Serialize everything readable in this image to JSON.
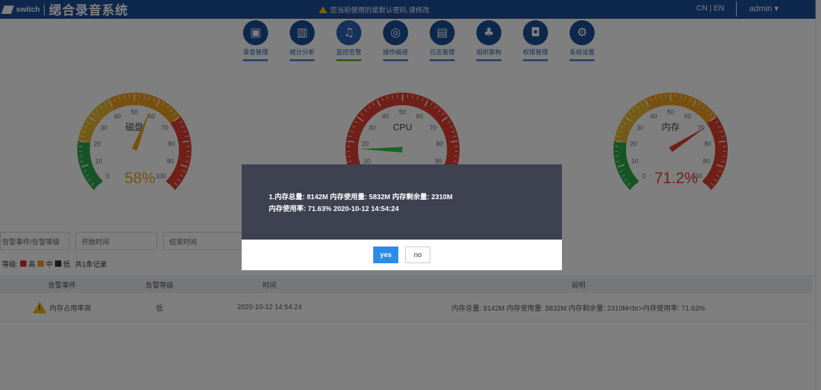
{
  "header": {
    "logo_text": "switch",
    "system_name": "缌合录音系统",
    "warning_text": "您当前使用的是默认密码,请修改",
    "language": "CN | EN",
    "user": "admin ▾"
  },
  "nav": {
    "items": [
      {
        "label": "录音管理",
        "icon": "▣"
      },
      {
        "label": "统计分析",
        "icon": "▥"
      },
      {
        "label": "监控告警",
        "icon": "♫"
      },
      {
        "label": "操作痕迹",
        "icon": "◎"
      },
      {
        "label": "日志管理",
        "icon": "▤"
      },
      {
        "label": "组织架构",
        "icon": "♣"
      },
      {
        "label": "权限管理",
        "icon": "◘"
      },
      {
        "label": "系统设置",
        "icon": "⚙"
      }
    ],
    "active_index": 2
  },
  "gauges": [
    {
      "name": "磁盘",
      "value_text": "58%",
      "value": 58,
      "value_color": "#f0a020",
      "needle_color": "#f0a020",
      "ticks": [
        "0",
        "10",
        "20",
        "30",
        "40",
        "50",
        "60",
        "70",
        "80",
        "90",
        "100"
      ]
    },
    {
      "name": "CPU",
      "value_text": "",
      "value": 17,
      "value_color": "#2ecc40",
      "needle_color": "#2ecc40",
      "ticks": [
        "",
        "10",
        "20",
        "30",
        "40",
        "50",
        "60",
        "70",
        "80",
        "90",
        ""
      ]
    },
    {
      "name": "内存",
      "value_text": "71.2%",
      "value": 71.2,
      "value_color": "#e04030",
      "needle_color": "#e04030",
      "ticks": [
        "0",
        "10",
        "20",
        "30",
        "40",
        "50",
        "60",
        "70",
        "80",
        "90",
        "100"
      ]
    }
  ],
  "filters": {
    "event_placeholder": "告警事件/告警等级",
    "start_placeholder": "开始时间",
    "end_placeholder": "结束时间"
  },
  "legend": {
    "prefix": "等级:",
    "high": "高",
    "medium": "中",
    "low": "低",
    "count": "共1条记录",
    "high_color": "#e0302a",
    "medium_color": "#f0a020",
    "low_color": "#333333"
  },
  "table": {
    "headers": [
      "告警事件",
      "告警等级",
      "时间",
      "说明"
    ],
    "rows": [
      {
        "event": "内存占用率高",
        "level": "低",
        "time": "2020-10-12 14:54:24",
        "description": "内存总量: 8142M 内存使用量: 5832M 内存剩余量: 2310M<br>内存使用率: 71.63%"
      }
    ]
  },
  "modal": {
    "line1": "1.内存总量: 8142M 内存使用量: 5832M 内存剩余量: 2310M",
    "line2": "内存使用率: 71.63% 2020-10-12 14:54:24",
    "yes_label": "yes",
    "no_label": "no"
  }
}
